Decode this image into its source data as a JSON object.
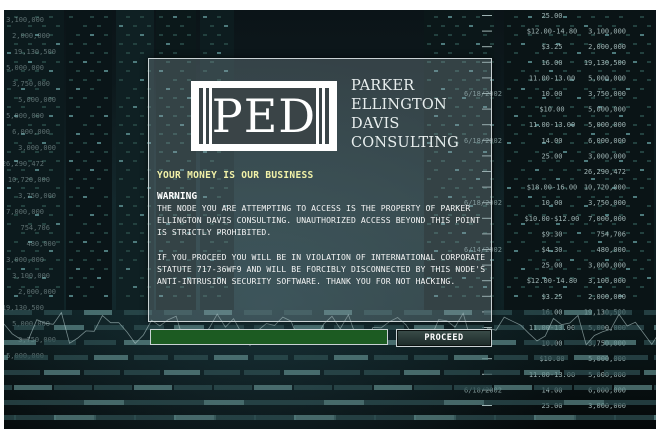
{
  "brand": {
    "logo_letters": "PED",
    "name_lines": [
      "PARKER",
      "ELLINGTON",
      "DAVIS",
      "CONSULTING"
    ]
  },
  "tagline": "YOUR MONEY IS OUR BUSINESS",
  "warning": {
    "title": "WARNING",
    "paragraph1": "THE NODE YOU ARE ATTEMPTING TO ACCESS IS THE PROPERTY OF PARKER ELLINGTON DAVIS CONSULTING. UNAUTHORIZED ACCESS BEYOND THIS POINT IS STRICTLY PROHIBITED.",
    "paragraph2": "IF YOU PROCEED YOU WILL BE IN VIOLATION OF INTERNATIONAL CORPORATE STATUTE 717-36WF9 AND WILL BE FORCIBLY DISCONNECTED BY THIS NODE'S ANTI-INTRUSION SECURITY SOFTWARE. THANK YOU FOR NOT HACKING."
  },
  "form": {
    "input_value": "",
    "input_placeholder": "",
    "proceed_label": "PROCEED"
  },
  "background_ticker": {
    "rows": [
      {
        "date": "",
        "a": "25.00",
        "b": ""
      },
      {
        "date": "",
        "a": "$12.00-14.80",
        "b": "3,100,000"
      },
      {
        "date": "",
        "a": "$3.25",
        "b": "2,000,000"
      },
      {
        "date": "",
        "a": "16.00",
        "b": "19,130,500"
      },
      {
        "date": "",
        "a": "11.00-13.00",
        "b": "5,000,000"
      },
      {
        "date": "6/18/2002",
        "a": "10.00",
        "b": "3,750,000"
      },
      {
        "date": "",
        "a": "$10.00",
        "b": "5,000,000"
      },
      {
        "date": "",
        "a": "11.00-13.00",
        "b": "5,000,000"
      },
      {
        "date": "6/18/2002",
        "a": "14.00",
        "b": "6,000,000"
      },
      {
        "date": "",
        "a": "25.00",
        "b": "3,000,000"
      },
      {
        "date": "",
        "a": "",
        "b": "26,290,472"
      },
      {
        "date": "",
        "a": "$18.00-16.00",
        "b": "10,720,000"
      },
      {
        "date": "6/18/2002",
        "a": "10.00",
        "b": "3,750,000"
      },
      {
        "date": "",
        "a": "$10.00-$12.00",
        "b": "7,000,000"
      },
      {
        "date": "",
        "a": "$9.30",
        "b": "754,706"
      },
      {
        "date": "6/14/2002",
        "a": "$4.30",
        "b": "480,000"
      },
      {
        "date": "",
        "a": "25.00",
        "b": "3,000,000"
      },
      {
        "date": "",
        "a": "$12.00-14.80",
        "b": "3,100,000"
      },
      {
        "date": "",
        "a": "$3.25",
        "b": "2,000,000"
      },
      {
        "date": "",
        "a": "16.00",
        "b": "19,130,500"
      },
      {
        "date": "",
        "a": "11.00-13.00",
        "b": "5,000,000"
      },
      {
        "date": "",
        "a": "10.00",
        "b": "3,750,000"
      },
      {
        "date": "",
        "a": "$10.00",
        "b": "5,000,000"
      },
      {
        "date": "",
        "a": "11.00-13.00",
        "b": "5,000,000"
      },
      {
        "date": "6/18/2002",
        "a": "14.00",
        "b": "6,000,000"
      },
      {
        "date": "",
        "a": "25.00",
        "b": "3,000,000"
      }
    ],
    "left_numbers": [
      "3,100,000",
      "2,000,000",
      "19,130,500",
      "5,000,000",
      "3,750,000",
      "5,000,000",
      "5,000,000",
      "6,000,000",
      "3,000,000",
      "26,290,472",
      "10,720,000",
      "3,750,000",
      "7,000,000",
      "754,706",
      "480,000",
      "3,000,000",
      "3,100,000",
      "2,000,000",
      "19,130,500",
      "5,000,000",
      "3,750,000",
      "5,000,000"
    ]
  },
  "colors": {
    "tagline": "#f2f2a8",
    "input_bg": "#1c5b22",
    "panel_border": "#c9d2d4"
  }
}
